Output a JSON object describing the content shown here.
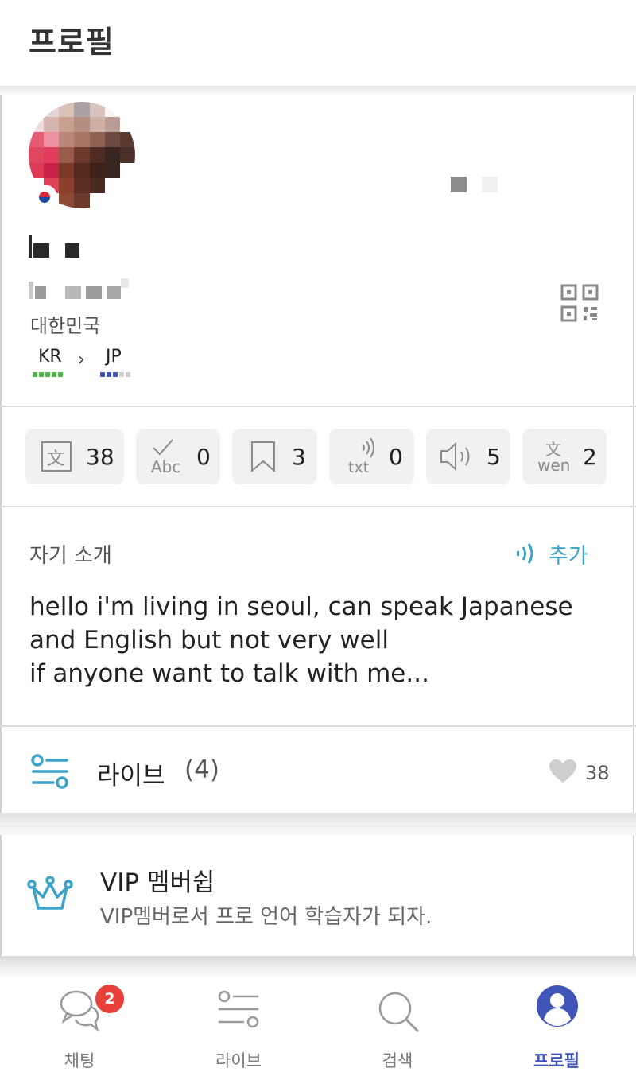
{
  "header": {
    "title": "프로필"
  },
  "profile": {
    "country": "대한민국",
    "native_language": "KR",
    "learning_language": "JP",
    "arrow": "›",
    "native_level": 5,
    "learning_level": 3,
    "level_max": 5
  },
  "stats": [
    {
      "icon": "translate-icon",
      "value": "38"
    },
    {
      "icon": "correction-icon",
      "value": "0"
    },
    {
      "icon": "bookmark-icon",
      "value": "3"
    },
    {
      "icon": "speech-to-text-icon",
      "value": "0"
    },
    {
      "icon": "speaker-icon",
      "value": "5"
    },
    {
      "icon": "pronunciation-icon",
      "value": "2"
    }
  ],
  "stat_icon_text": {
    "abc": "Abc",
    "txt": "txt",
    "wen_top": "文",
    "wen_bottom": "wen",
    "bunzi": "文"
  },
  "intro": {
    "label": "자기 소개",
    "add_label": "추가",
    "lines": [
      "hello i'm living in seoul, can speak Japanese",
      "and English but not very well",
      "if anyone want to talk with me..."
    ]
  },
  "live": {
    "label": "라이브",
    "count": "(4)",
    "likes": "38"
  },
  "vip": {
    "title": "VIP 멤버쉽",
    "subtitle": "VIP멤버로서 프로 언어 학습자가 되자."
  },
  "nav": {
    "items": [
      {
        "label": "채팅",
        "icon": "chat-icon",
        "badge": "2"
      },
      {
        "label": "라이브",
        "icon": "live-icon"
      },
      {
        "label": "검색",
        "icon": "search-icon"
      },
      {
        "label": "프로필",
        "icon": "profile-icon",
        "active": true
      }
    ]
  },
  "colors": {
    "accent_teal": "#3da3c9",
    "nav_active": "#3f55b8",
    "badge_red": "#e8413b",
    "native_level_green": "#4cb848",
    "learning_level_blue": "#3f55b8"
  }
}
